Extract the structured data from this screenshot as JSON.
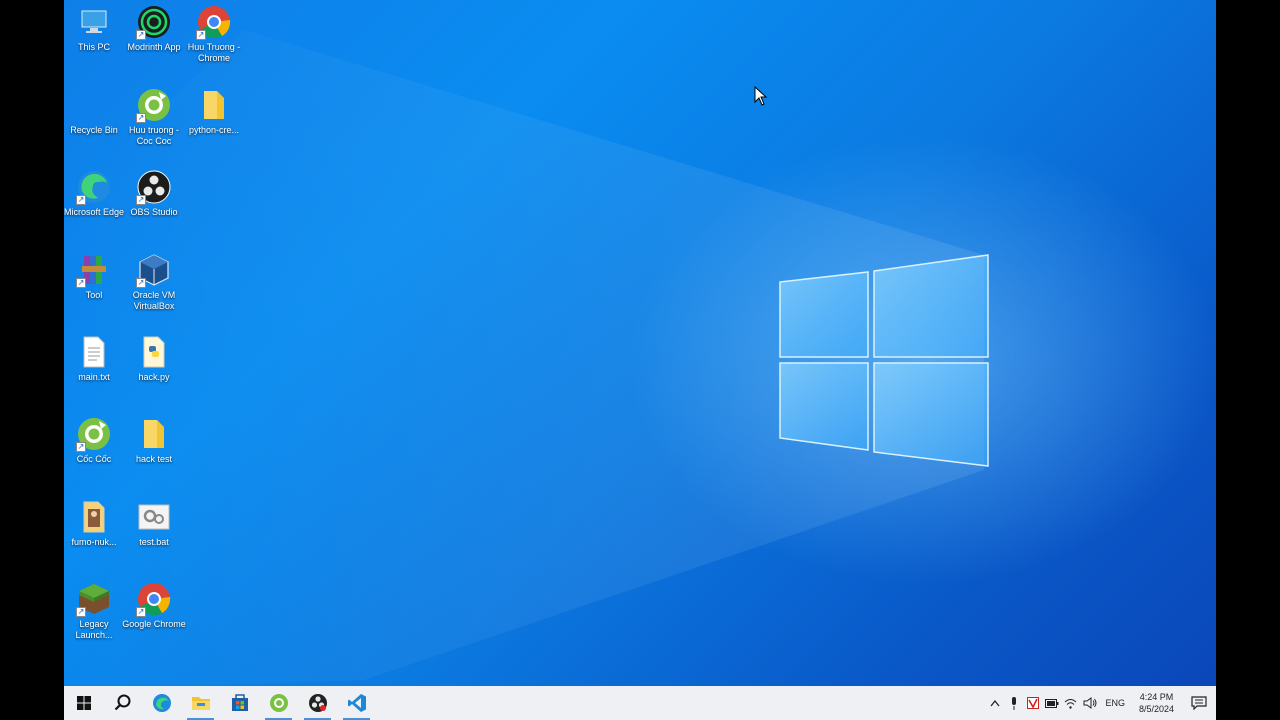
{
  "desktop": {
    "icons": [
      {
        "label": "This PC",
        "icon": "this-pc-icon"
      },
      {
        "label": "Modrinth App",
        "icon": "modrinth-icon"
      },
      {
        "label": "Huu Truong - Chrome",
        "icon": "chrome-icon"
      },
      {
        "label": "Recycle Bin",
        "icon": "recycle-bin-icon"
      },
      {
        "label": "Huu truong - Coc Coc",
        "icon": "coccoc-icon"
      },
      {
        "label": "python-cre...",
        "icon": "folder-icon"
      },
      {
        "label": "Microsoft Edge",
        "icon": "edge-icon"
      },
      {
        "label": "OBS Studio",
        "icon": "obs-icon"
      },
      {
        "label": "Tool",
        "icon": "winrar-icon"
      },
      {
        "label": "Oracle VM VirtualBox",
        "icon": "virtualbox-icon"
      },
      {
        "label": "main.txt",
        "icon": "text-file-icon"
      },
      {
        "label": "hack.py",
        "icon": "python-file-icon"
      },
      {
        "label": "Cốc Cốc",
        "icon": "coccoc-icon"
      },
      {
        "label": "hack test",
        "icon": "folder-icon"
      },
      {
        "label": "fumo-nuk...",
        "icon": "image-file-icon"
      },
      {
        "label": "test.bat",
        "icon": "batch-file-icon"
      },
      {
        "label": "Legacy Launch...",
        "icon": "minecraft-icon"
      },
      {
        "label": "Google Chrome",
        "icon": "chrome-icon"
      }
    ]
  },
  "taskbar": {
    "items": [
      {
        "name": "start-button",
        "icon": "windows-logo-icon"
      },
      {
        "name": "search-button",
        "icon": "search-icon"
      },
      {
        "name": "taskbar-edge",
        "icon": "edge-icon"
      },
      {
        "name": "taskbar-file-explorer",
        "icon": "folder-icon"
      },
      {
        "name": "taskbar-store",
        "icon": "store-icon"
      },
      {
        "name": "taskbar-coccoc",
        "icon": "coccoc-icon"
      },
      {
        "name": "taskbar-obs",
        "icon": "obs-icon"
      },
      {
        "name": "taskbar-vscode",
        "icon": "vscode-icon"
      }
    ],
    "tray": {
      "language": "ENG",
      "time": "4:24 PM",
      "date": "8/5/2024"
    }
  },
  "colors": {
    "wallpaper_blue": "#0a7fe6",
    "taskbar": "#eef0f3",
    "accent": "#4a90d9"
  }
}
